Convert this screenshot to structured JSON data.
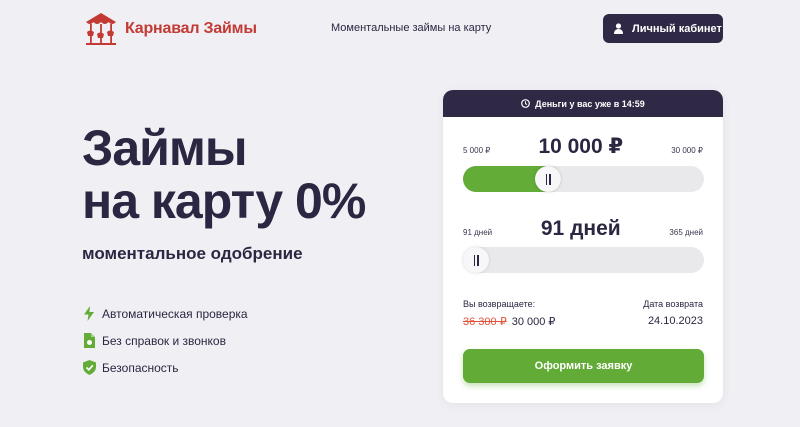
{
  "header": {
    "brand": "Карнавал Займы",
    "nav_link": "Моментальные займы на карту",
    "cabinet_button": "Личный кабинет"
  },
  "hero": {
    "title_line1": "Займы",
    "title_line2": "на карту 0%",
    "subtitle": "моментальное одобрение",
    "features": [
      {
        "label": "Автоматическая проверка",
        "icon": "lightning-icon"
      },
      {
        "label": "Без справок и звонков",
        "icon": "document-icon"
      },
      {
        "label": "Безопасность",
        "icon": "shield-check-icon"
      }
    ]
  },
  "calculator": {
    "banner_text": "Деньги у вас уже в 14:59",
    "amount": {
      "min_label": "5 000 ₽",
      "max_label": "30 000 ₽",
      "value_label": "10 000 ₽",
      "value": 10000,
      "min": 5000,
      "max": 30000
    },
    "term": {
      "min_label": "91 дней",
      "max_label": "365 дней",
      "value_label": "91 дней",
      "value": 91,
      "min": 91,
      "max": 365
    },
    "return_label": "Вы возвращаете:",
    "return_old": "36 300 ₽",
    "return_new": "30 000 ₽",
    "date_label": "Дата возврата",
    "date_value": "24.10.2023",
    "apply_button": "Оформить заявку"
  },
  "colors": {
    "brand_red": "#c33a35",
    "dark": "#2f2945",
    "green": "#63ac38",
    "strike_red": "#e0533b",
    "background": "#f0f0f4"
  }
}
